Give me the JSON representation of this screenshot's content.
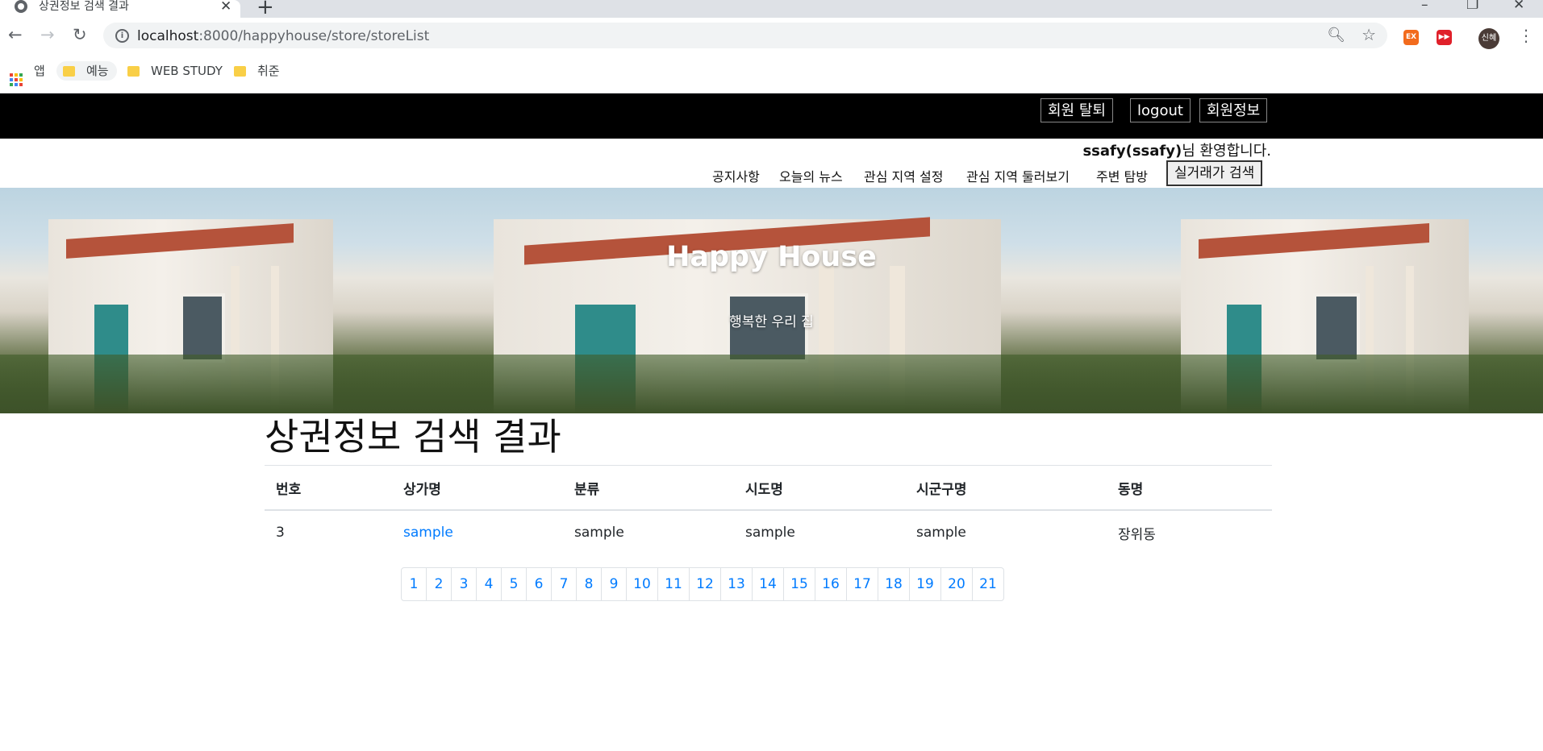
{
  "browser": {
    "tab_title": "상권정보 검색 결과",
    "url_host": "localhost",
    "url_rest": ":8000/happyhouse/store/storeList",
    "bookmarks": [
      "앱",
      "예능",
      "WEB STUDY",
      "취준"
    ],
    "extensions": [
      {
        "label": "EX",
        "color": "#f26b1d"
      },
      {
        "label": "▶▶",
        "color": "#e0202a"
      }
    ],
    "profile_label": "신혜"
  },
  "header": {
    "buttons": [
      "회원 탈퇴",
      "logout",
      "회원정보"
    ],
    "welcome_user": "ssafy(ssafy)",
    "welcome_suffix": "님 환영합니다.",
    "nav": [
      "공지사항",
      "오늘의 뉴스",
      "관심 지역 설정",
      "관심 지역 둘러보기",
      "주변 탐방"
    ],
    "nav_button": "실거래가 검색"
  },
  "hero": {
    "title": "Happy House",
    "subtitle": "행복한 우리 집"
  },
  "main": {
    "heading": "상권정보 검색 결과",
    "columns": [
      "번호",
      "상가명",
      "분류",
      "시도명",
      "시군구명",
      "동명"
    ],
    "rows": [
      [
        "3",
        "sample",
        "sample",
        "sample",
        "sample",
        "장위동"
      ]
    ]
  },
  "pagination": [
    "1",
    "2",
    "3",
    "4",
    "5",
    "6",
    "7",
    "8",
    "9",
    "10",
    "11",
    "12",
    "13",
    "14",
    "15",
    "16",
    "17",
    "18",
    "19",
    "20",
    "21"
  ]
}
